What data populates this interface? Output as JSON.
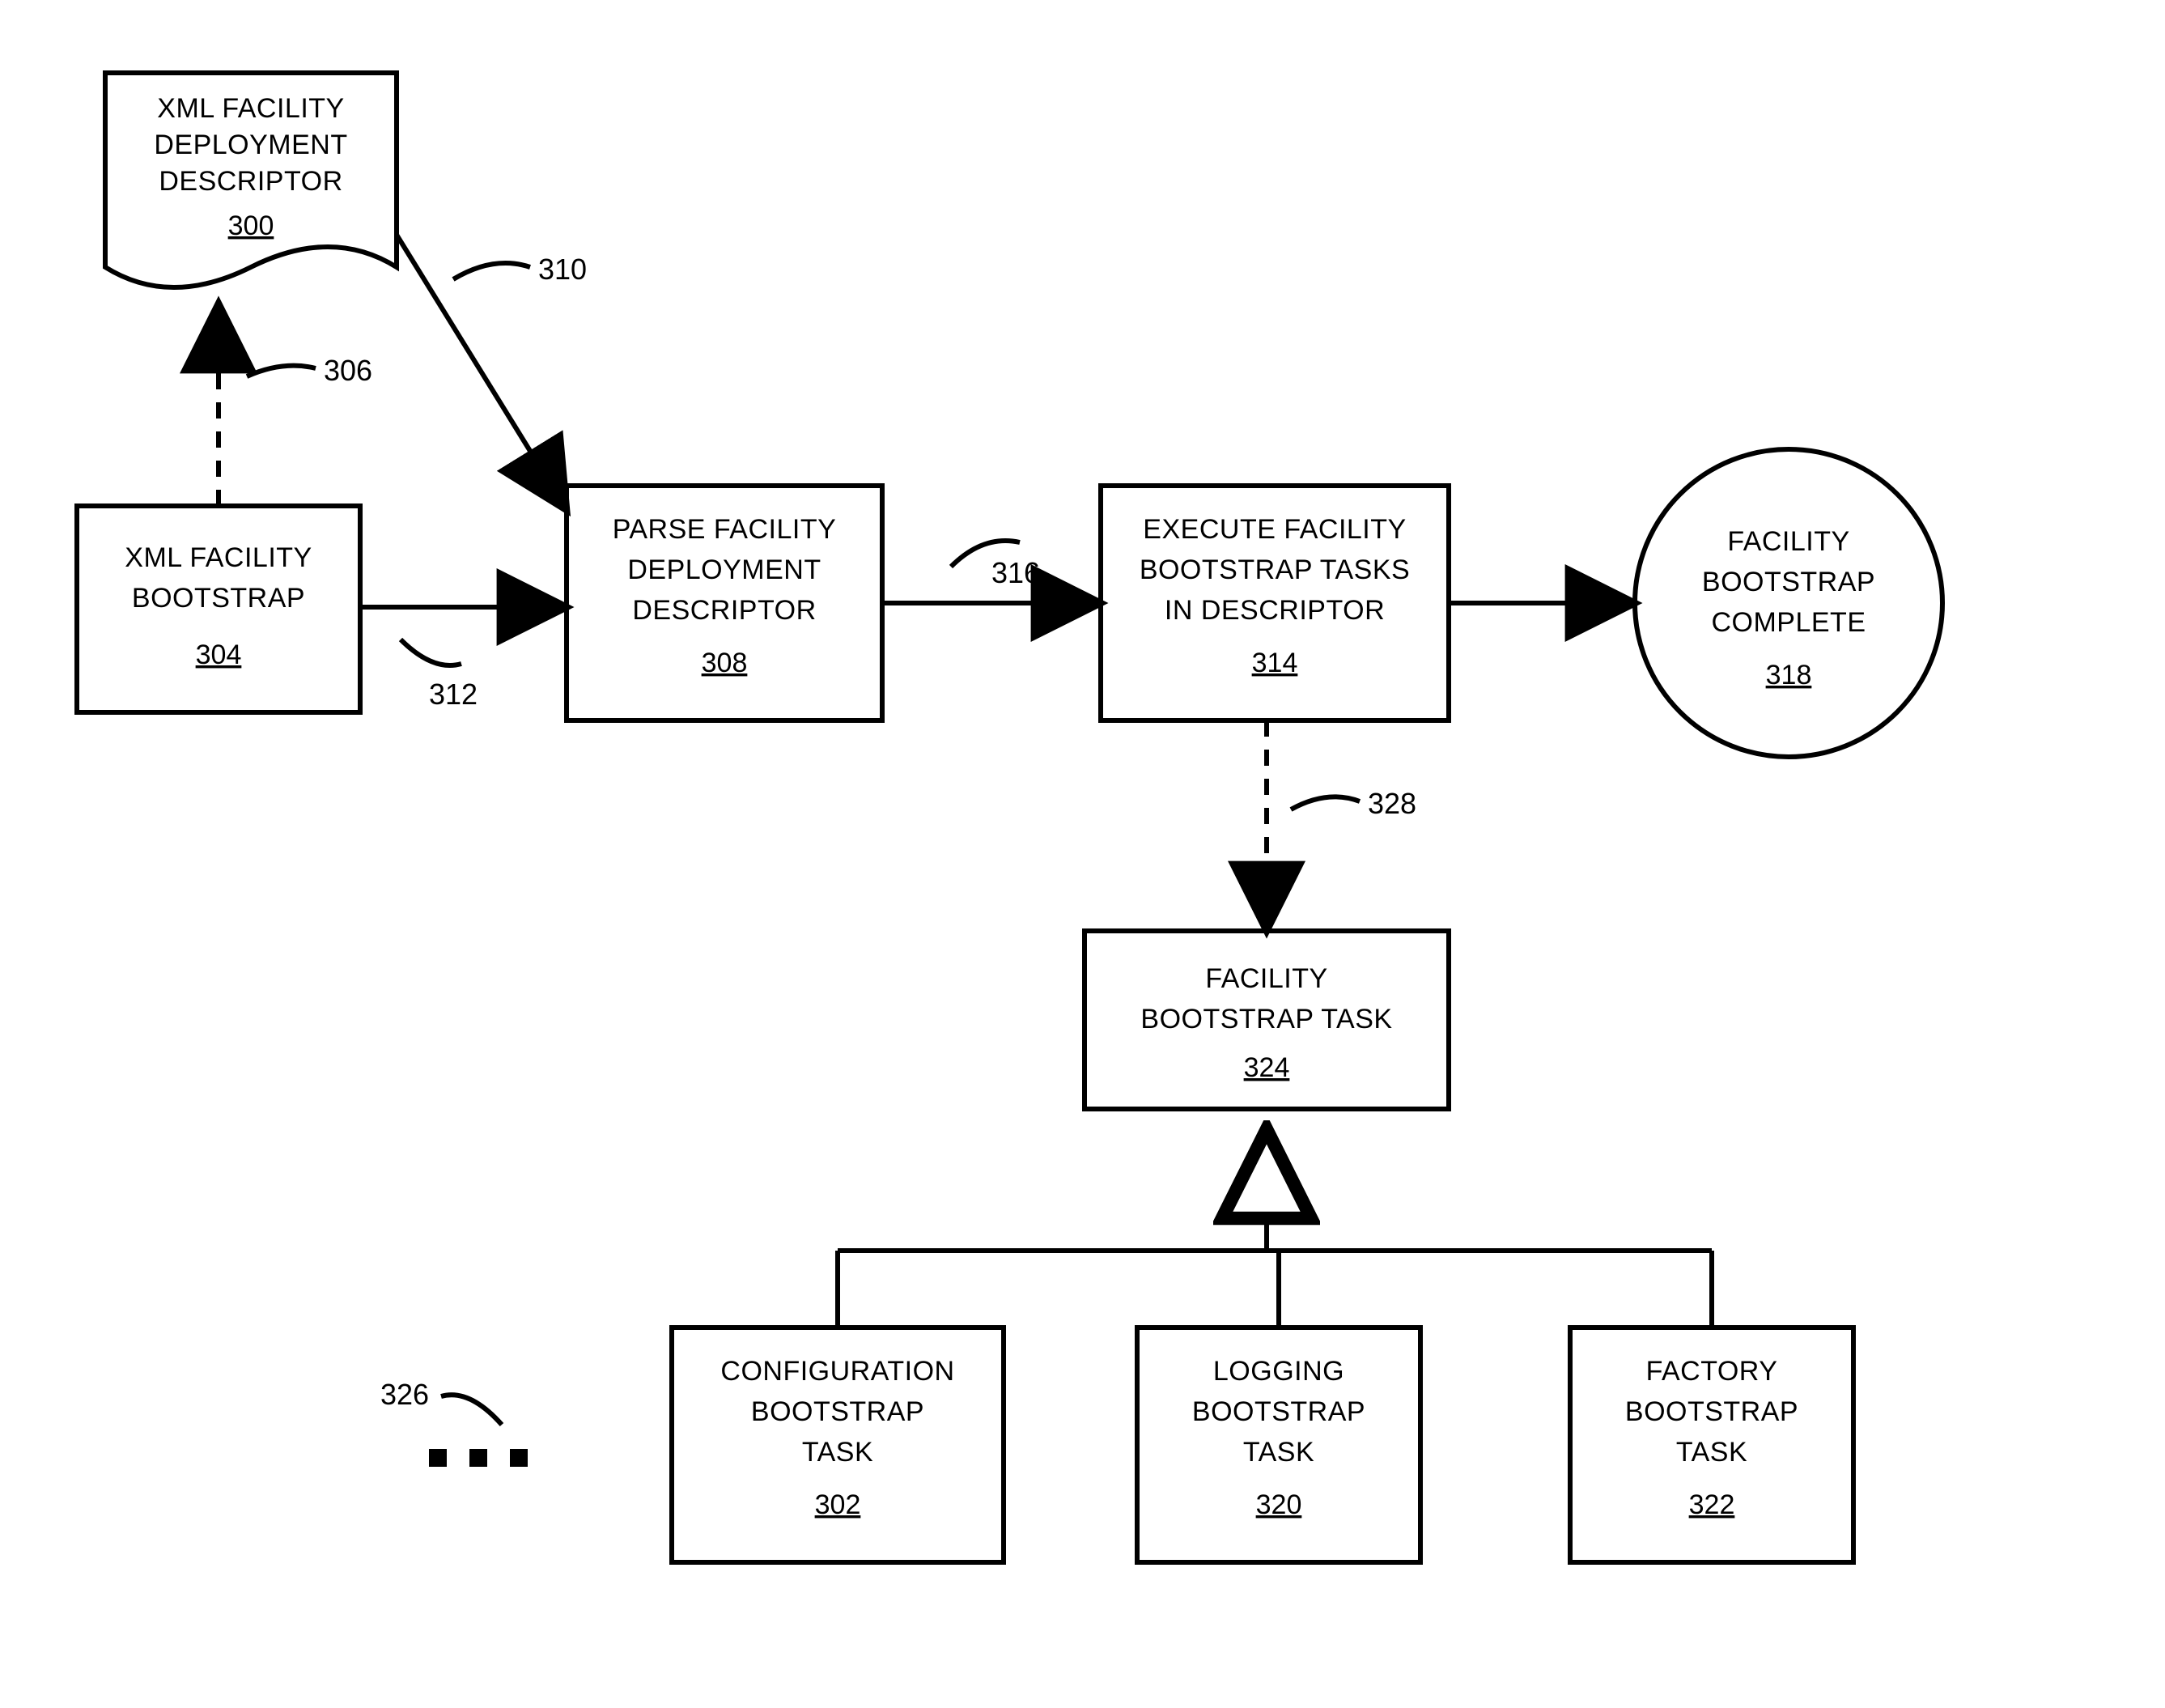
{
  "nodes": {
    "n300": {
      "l1": "XML FACILITY",
      "l2": "DEPLOYMENT",
      "l3": "DESCRIPTOR",
      "ref": "300"
    },
    "n304": {
      "l1": "XML FACILITY",
      "l2": "BOOTSTRAP",
      "ref": "304"
    },
    "n308": {
      "l1": "PARSE FACILITY",
      "l2": "DEPLOYMENT",
      "l3": "DESCRIPTOR",
      "ref": "308"
    },
    "n314": {
      "l1": "EXECUTE FACILITY",
      "l2": "BOOTSTRAP TASKS",
      "l3": "IN DESCRIPTOR",
      "ref": "314"
    },
    "n318": {
      "l1": "FACILITY",
      "l2": "BOOTSTRAP",
      "l3": "COMPLETE",
      "ref": "318"
    },
    "n324": {
      "l1": "FACILITY",
      "l2": "BOOTSTRAP TASK",
      "ref": "324"
    },
    "n302": {
      "l1": "CONFIGURATION",
      "l2": "BOOTSTRAP",
      "l3": "TASK",
      "ref": "302"
    },
    "n320": {
      "l1": "LOGGING",
      "l2": "BOOTSTRAP",
      "l3": "TASK",
      "ref": "320"
    },
    "n322": {
      "l1": "FACTORY",
      "l2": "BOOTSTRAP",
      "l3": "TASK",
      "ref": "322"
    }
  },
  "callouts": {
    "c306": "306",
    "c310": "310",
    "c312": "312",
    "c316": "316",
    "c328": "328",
    "c326": "326"
  }
}
